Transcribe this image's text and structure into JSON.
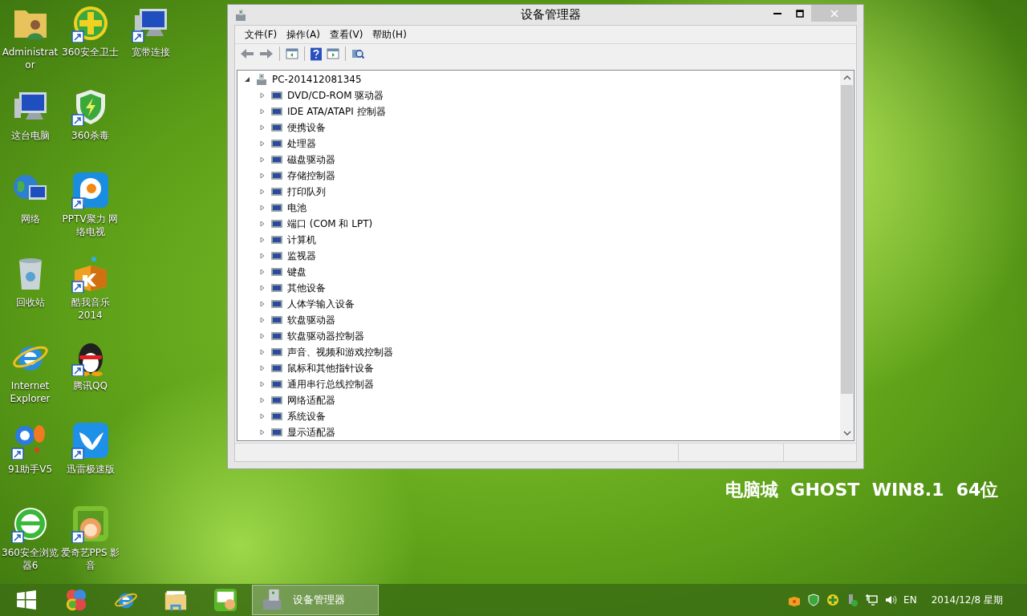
{
  "desktop": {
    "columns": [
      [
        {
          "label": "Administrator",
          "shortcut": false
        },
        {
          "label": "这台电脑",
          "shortcut": false
        },
        {
          "label": "网络",
          "shortcut": false
        },
        {
          "label": "回收站",
          "shortcut": false
        },
        {
          "label": "Internet Explorer",
          "shortcut": false
        },
        {
          "label": "91助手V5",
          "shortcut": true
        },
        {
          "label": "360安全浏览器6",
          "shortcut": true
        }
      ],
      [
        {
          "label": "360安全卫士",
          "shortcut": true
        },
        {
          "label": "360杀毒",
          "shortcut": true
        },
        {
          "label": "PPTV聚力 网络电视",
          "shortcut": true
        },
        {
          "label": "酷我音乐 2014",
          "shortcut": true
        },
        {
          "label": "腾讯QQ",
          "shortcut": true
        },
        {
          "label": "迅雷极速版",
          "shortcut": true
        },
        {
          "label": "爱奇艺PPS 影音",
          "shortcut": true
        }
      ],
      [
        {
          "label": "宽带连接",
          "shortcut": true
        }
      ]
    ],
    "wallpaper_text": "电脑城  GHOST  WIN8.1  64位"
  },
  "window": {
    "title": "设备管理器",
    "menu": [
      "文件(F)",
      "操作(A)",
      "查看(V)",
      "帮助(H)"
    ],
    "tree": {
      "label": "PC-201412081345",
      "expanded": true,
      "children": [
        {
          "label": "DVD/CD-ROM 驱动器",
          "expanded": false
        },
        {
          "label": "IDE ATA/ATAPI 控制器",
          "expanded": false
        },
        {
          "label": "便携设备",
          "expanded": false
        },
        {
          "label": "处理器",
          "expanded": false
        },
        {
          "label": "磁盘驱动器",
          "expanded": false
        },
        {
          "label": "存储控制器",
          "expanded": false
        },
        {
          "label": "打印队列",
          "expanded": false
        },
        {
          "label": "电池",
          "expanded": false
        },
        {
          "label": "端口 (COM 和 LPT)",
          "expanded": false
        },
        {
          "label": "计算机",
          "expanded": false
        },
        {
          "label": "监视器",
          "expanded": false
        },
        {
          "label": "键盘",
          "expanded": false
        },
        {
          "label": "其他设备",
          "expanded": false
        },
        {
          "label": "人体学输入设备",
          "expanded": false
        },
        {
          "label": "软盘驱动器",
          "expanded": false
        },
        {
          "label": "软盘驱动器控制器",
          "expanded": false
        },
        {
          "label": "声音、视频和游戏控制器",
          "expanded": false
        },
        {
          "label": "鼠标和其他指针设备",
          "expanded": false
        },
        {
          "label": "通用串行总线控制器",
          "expanded": false
        },
        {
          "label": "网络适配器",
          "expanded": false
        },
        {
          "label": "系统设备",
          "expanded": false
        },
        {
          "label": "显示适配器",
          "expanded": false
        }
      ]
    }
  },
  "taskbar": {
    "task": {
      "label": "设备管理器",
      "selected": true
    },
    "language": "EN",
    "date": "2014/12/8 星期"
  }
}
